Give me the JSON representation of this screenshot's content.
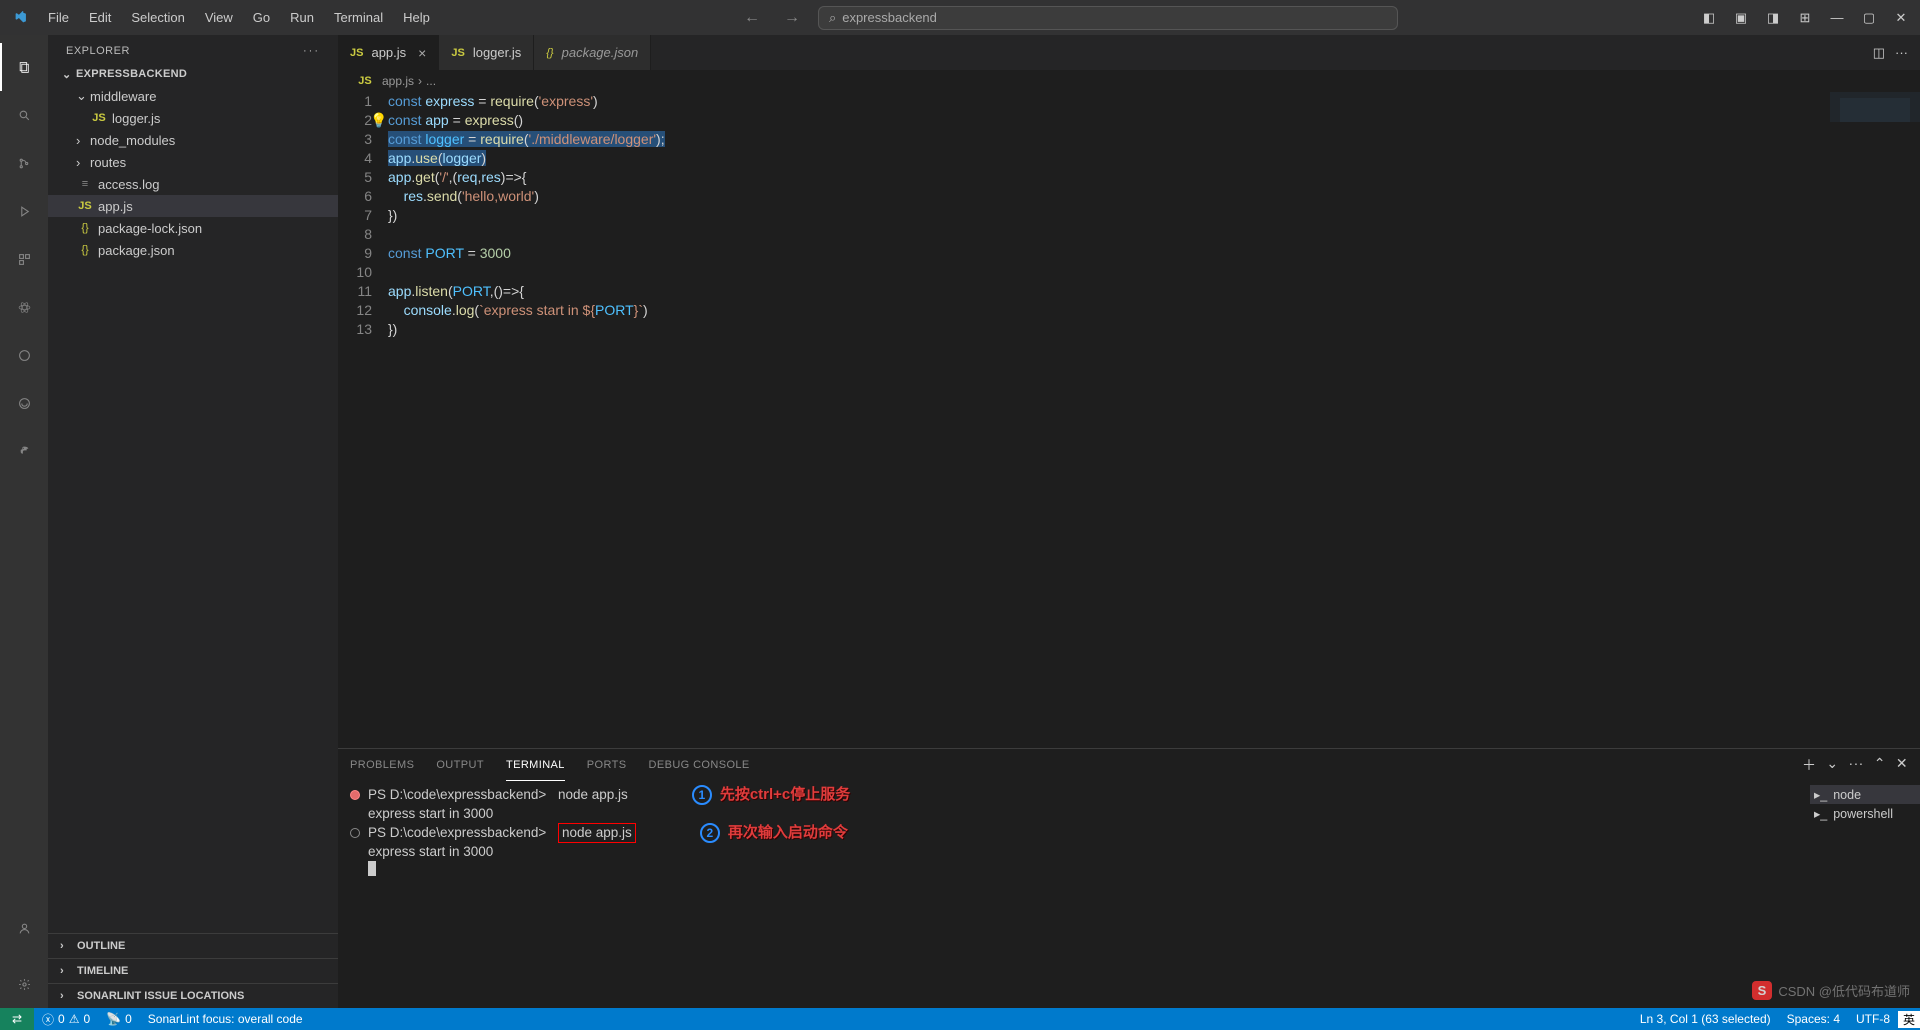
{
  "window": {
    "search": "expressbackend"
  },
  "menu": [
    "File",
    "Edit",
    "Selection",
    "View",
    "Go",
    "Run",
    "Terminal",
    "Help"
  ],
  "sidebar": {
    "title": "EXPLORER",
    "project": "EXPRESSBACKEND",
    "tree": [
      {
        "type": "folder",
        "label": "middleware",
        "depth": 1,
        "open": true
      },
      {
        "type": "file",
        "label": "logger.js",
        "depth": 2,
        "icon": "js"
      },
      {
        "type": "folder",
        "label": "node_modules",
        "depth": 1,
        "open": false
      },
      {
        "type": "folder",
        "label": "routes",
        "depth": 1,
        "open": false
      },
      {
        "type": "file",
        "label": "access.log",
        "depth": 1,
        "icon": "log"
      },
      {
        "type": "file",
        "label": "app.js",
        "depth": 1,
        "icon": "js",
        "active": true
      },
      {
        "type": "file",
        "label": "package-lock.json",
        "depth": 1,
        "icon": "json"
      },
      {
        "type": "file",
        "label": "package.json",
        "depth": 1,
        "icon": "json"
      }
    ],
    "sections": [
      "OUTLINE",
      "TIMELINE",
      "SONARLINT ISSUE LOCATIONS"
    ]
  },
  "tabs": [
    {
      "label": "app.js",
      "icon": "js",
      "active": true,
      "close": true
    },
    {
      "label": "logger.js",
      "icon": "js"
    },
    {
      "label": "package.json",
      "icon": "json",
      "italic": true
    }
  ],
  "breadcrumb": [
    "app.js",
    "..."
  ],
  "code": {
    "lines": [
      [
        [
          "kw",
          "const"
        ],
        [
          "",
          ""
        ],
        [
          "var",
          " express"
        ],
        [
          "",
          " = "
        ],
        [
          "fn",
          "require"
        ],
        [
          "",
          "("
        ],
        [
          "str",
          "'express'"
        ],
        [
          "",
          ")"
        ]
      ],
      [
        [
          "kw",
          "const"
        ],
        [
          "var",
          " app"
        ],
        [
          "",
          " = "
        ],
        [
          "fn",
          "express"
        ],
        [
          "",
          "()"
        ]
      ],
      [
        [
          "hl",
          "const logger = require('./middleware/logger');"
        ]
      ],
      [
        [
          "hl2",
          "app.use(logger)"
        ]
      ],
      [
        [
          "var",
          "app"
        ],
        [
          "",
          "."
        ],
        [
          "fn",
          "get"
        ],
        [
          "",
          "("
        ],
        [
          "str",
          "'/'"
        ],
        [
          "",
          ",("
        ],
        [
          "var",
          "req"
        ],
        [
          "",
          ","
        ],
        [
          "var",
          "res"
        ],
        [
          "",
          ")=>"
        ],
        [
          "",
          "{"
        ]
      ],
      [
        [
          "",
          "    "
        ],
        [
          "var",
          "res"
        ],
        [
          "",
          "."
        ],
        [
          "fn",
          "send"
        ],
        [
          "",
          "("
        ],
        [
          "str",
          "'hello,world'"
        ],
        [
          "",
          ")"
        ]
      ],
      [
        [
          "",
          "})"
        ]
      ],
      [
        [
          "",
          ""
        ]
      ],
      [
        [
          "kw",
          "const"
        ],
        [
          "id",
          " PORT"
        ],
        [
          "",
          " = "
        ],
        [
          "num",
          "3000"
        ]
      ],
      [
        [
          "",
          ""
        ]
      ],
      [
        [
          "var",
          "app"
        ],
        [
          "",
          "."
        ],
        [
          "fn",
          "listen"
        ],
        [
          "",
          "("
        ],
        [
          "id",
          "PORT"
        ],
        [
          "",
          ",()=>"
        ],
        [
          "",
          "{"
        ]
      ],
      [
        [
          "",
          "    "
        ],
        [
          "var",
          "console"
        ],
        [
          "",
          "."
        ],
        [
          "fn",
          "log"
        ],
        [
          "",
          "("
        ],
        [
          "str",
          "`express start in ${"
        ],
        [
          "id",
          "PORT"
        ],
        [
          "str",
          "}`"
        ],
        [
          "",
          ")"
        ]
      ],
      [
        [
          "",
          "})"
        ]
      ]
    ]
  },
  "panel": {
    "tabs": [
      "PROBLEMS",
      "OUTPUT",
      "TERMINAL",
      "PORTS",
      "DEBUG CONSOLE"
    ],
    "activeTab": 2,
    "terminals": [
      "node",
      "powershell"
    ],
    "output": {
      "prompt": "PS D:\\code\\expressbackend>",
      "cmd": "node app.js",
      "result": "express start in 3000"
    },
    "annotations": [
      "先按ctrl+c停止服务",
      "再次输入启动命令"
    ]
  },
  "status": {
    "errors": "0",
    "warnings": "0",
    "ports": "0",
    "sonar": "SonarLint focus: overall code",
    "pos": "Ln 3, Col 1 (63 selected)",
    "spaces": "Spaces: 4",
    "encoding": "UTF-8",
    "ime": "英"
  },
  "watermark": {
    "badge": "S",
    "text": "CSDN @低代码布道师"
  }
}
